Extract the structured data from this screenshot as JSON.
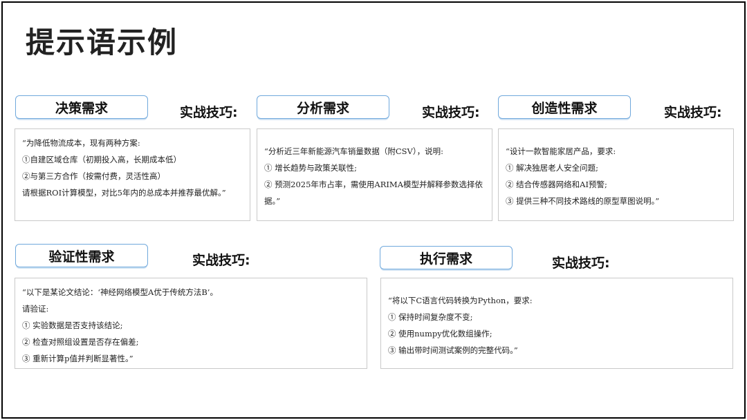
{
  "title": "提示语示例",
  "tip_label": "实战技巧:",
  "cards": [
    {
      "tab": "决策需求",
      "lines": [
        "“为降低物流成本，现有两种方案:",
        "①自建区域仓库（初期投入高，长期成本低）",
        "②与第三方合作（按需付费，灵活性高）",
        "请根据ROI计算模型，对比5年内的总成本并推荐最优解。”"
      ]
    },
    {
      "tab": "分析需求",
      "lines": [
        "“分析近三年新能源汽车销量数据（附CSV），说明:",
        "① 增长趋势与政策关联性;",
        "② 预测2025年市占率，需使用ARIMA模型并解释参数选择依据。”"
      ]
    },
    {
      "tab": "创造性需求",
      "lines": [
        "“设计一款智能家居产品，要求:",
        "① 解决独居老人安全问题;",
        "② 结合传感器网络和AI预警;",
        "③ 提供三种不同技术路线的原型草图说明。”"
      ]
    },
    {
      "tab": "验证性需求",
      "lines": [
        "“以下是某论文结论：‘神经网络模型A优于传统方法B’。",
        "请验证:",
        "① 实验数据是否支持该结论;",
        "② 检查对照组设置是否存在偏差;",
        "③ 重新计算p值并判断显著性。”"
      ]
    },
    {
      "tab": "执行需求",
      "lines": [
        "“将以下C语言代码转换为Python，要求:",
        "① 保持时间复杂度不变;",
        "② 使用numpy优化数组操作;",
        "③ 输出带时间测试案例的完整代码。”"
      ]
    }
  ]
}
